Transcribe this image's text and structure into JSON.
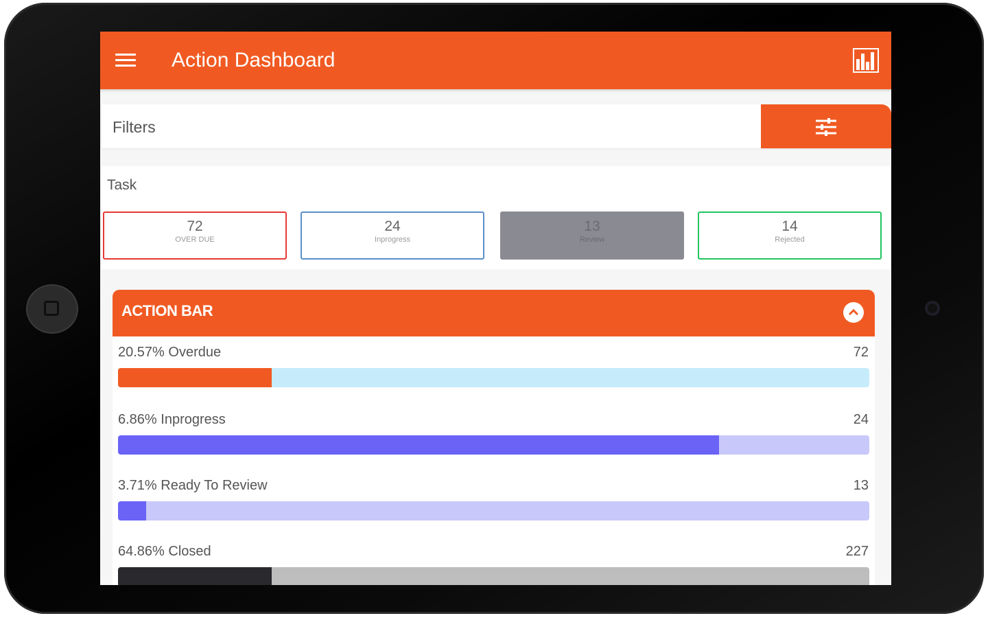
{
  "app": {
    "title": "Action Dashboard"
  },
  "filters": {
    "label": "Filters"
  },
  "task": {
    "label": "Task",
    "cards": [
      {
        "value": "72",
        "label": "OVER DUE"
      },
      {
        "value": "24",
        "label": "Inprogress"
      },
      {
        "value": "13",
        "label": "Review"
      },
      {
        "value": "14",
        "label": "Rejected"
      }
    ]
  },
  "action_bar": {
    "title": "ACTION BAR",
    "metrics": [
      {
        "label": "20.57% Overdue",
        "count": "72",
        "fill_fraction": 0.205,
        "fill_color": "#f05a22",
        "track_color": "#c6ecfb"
      },
      {
        "label": "6.86% Inprogress",
        "count": "24",
        "fill_fraction": 0.8,
        "fill_color": "#6a63f6",
        "track_color": "#c9c8fa"
      },
      {
        "label": "3.71% Ready To Review",
        "count": "13",
        "fill_fraction": 0.037,
        "fill_color": "#6a63f6",
        "track_color": "#c9c8fa"
      },
      {
        "label": "64.86% Closed",
        "count": "227",
        "fill_fraction": 0.205,
        "fill_color": "#2a2a2e",
        "track_color": "#bdbdbd"
      }
    ]
  },
  "colors": {
    "brand": "#f05a22"
  }
}
